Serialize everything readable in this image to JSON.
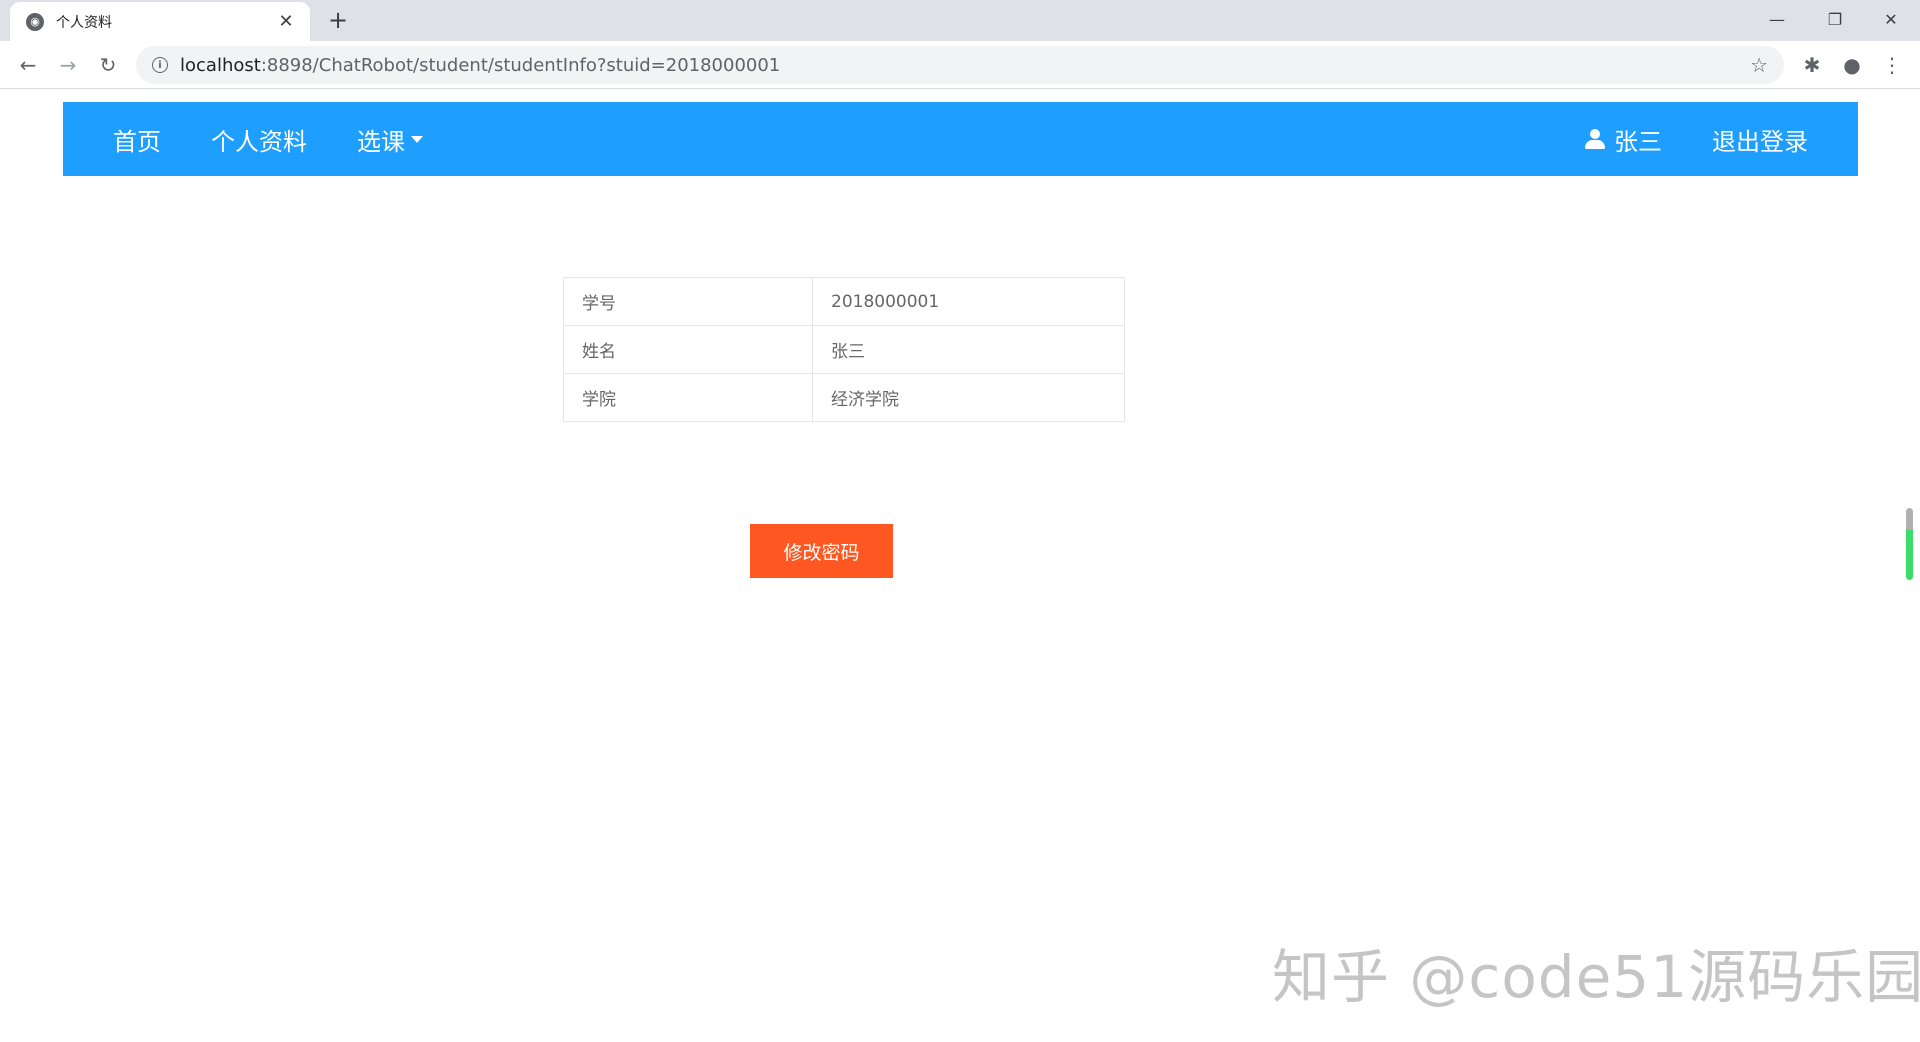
{
  "browser": {
    "tab_title": "个人资料",
    "tab_close": "✕",
    "new_tab": "+",
    "url_host": "localhost",
    "url_rest": ":8898/ChatRobot/student/studentInfo?stuid=2018000001",
    "window_minimize": "—",
    "window_restore": "❐",
    "window_close": "✕"
  },
  "navbar": {
    "home": "首页",
    "profile": "个人资料",
    "courses": "选课",
    "username": "张三",
    "logout": "退出登录",
    "accent_color": "#1e9fff"
  },
  "student_info": {
    "rows": [
      {
        "label": "学号",
        "value": "2018000001"
      },
      {
        "label": "姓名",
        "value": "张三"
      },
      {
        "label": "学院",
        "value": "经济学院"
      }
    ]
  },
  "actions": {
    "change_password": "修改密码",
    "button_color": "#ff5722"
  },
  "watermark": "知乎 @code51源码乐园"
}
